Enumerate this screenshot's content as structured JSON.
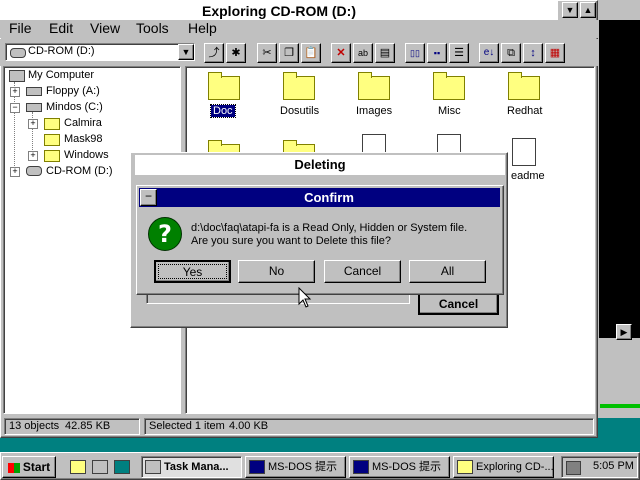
{
  "window": {
    "title": "Exploring CD-ROM (D:)"
  },
  "menu": [
    "File",
    "Edit",
    "View",
    "Tools",
    "Help"
  ],
  "address": {
    "value": "CD-ROM (D:)"
  },
  "tree": [
    {
      "label": "My Computer"
    },
    {
      "label": "Floppy (A:)"
    },
    {
      "label": "Mindos (C:)"
    },
    {
      "label": "Calmira"
    },
    {
      "label": "Mask98"
    },
    {
      "label": "Windows"
    },
    {
      "label": "CD-ROM (D:)"
    }
  ],
  "files": [
    {
      "label": "Doc"
    },
    {
      "label": "Dosutils"
    },
    {
      "label": "Images"
    },
    {
      "label": "Misc"
    },
    {
      "label": "Redhat"
    },
    {
      "label": "eadme"
    }
  ],
  "status": {
    "objects": "13 objects",
    "size": "42.85 KB",
    "selected": "Selected 1 item",
    "selected_size": "4.00 KB"
  },
  "deleting": {
    "title": "Deleting",
    "cancel": "Cancel"
  },
  "confirm": {
    "title": "Confirm",
    "line1": "d:\\doc\\faq\\atapi-fa is a Read Only, Hidden or System file.",
    "line2": "Are you sure you want to Delete this file?",
    "buttons": {
      "yes": "Yes",
      "no": "No",
      "cancel": "Cancel",
      "all": "All"
    }
  },
  "taskbar": {
    "start": "Start",
    "tasks": [
      "Task Mana...",
      "MS-DOS 提示",
      "MS-DOS 提示",
      "Exploring CD-..."
    ],
    "clock": "5:05 PM"
  },
  "colors": {
    "titlebar_active": "#000080",
    "face": "#c0c0c0",
    "desktop": "#008080"
  }
}
